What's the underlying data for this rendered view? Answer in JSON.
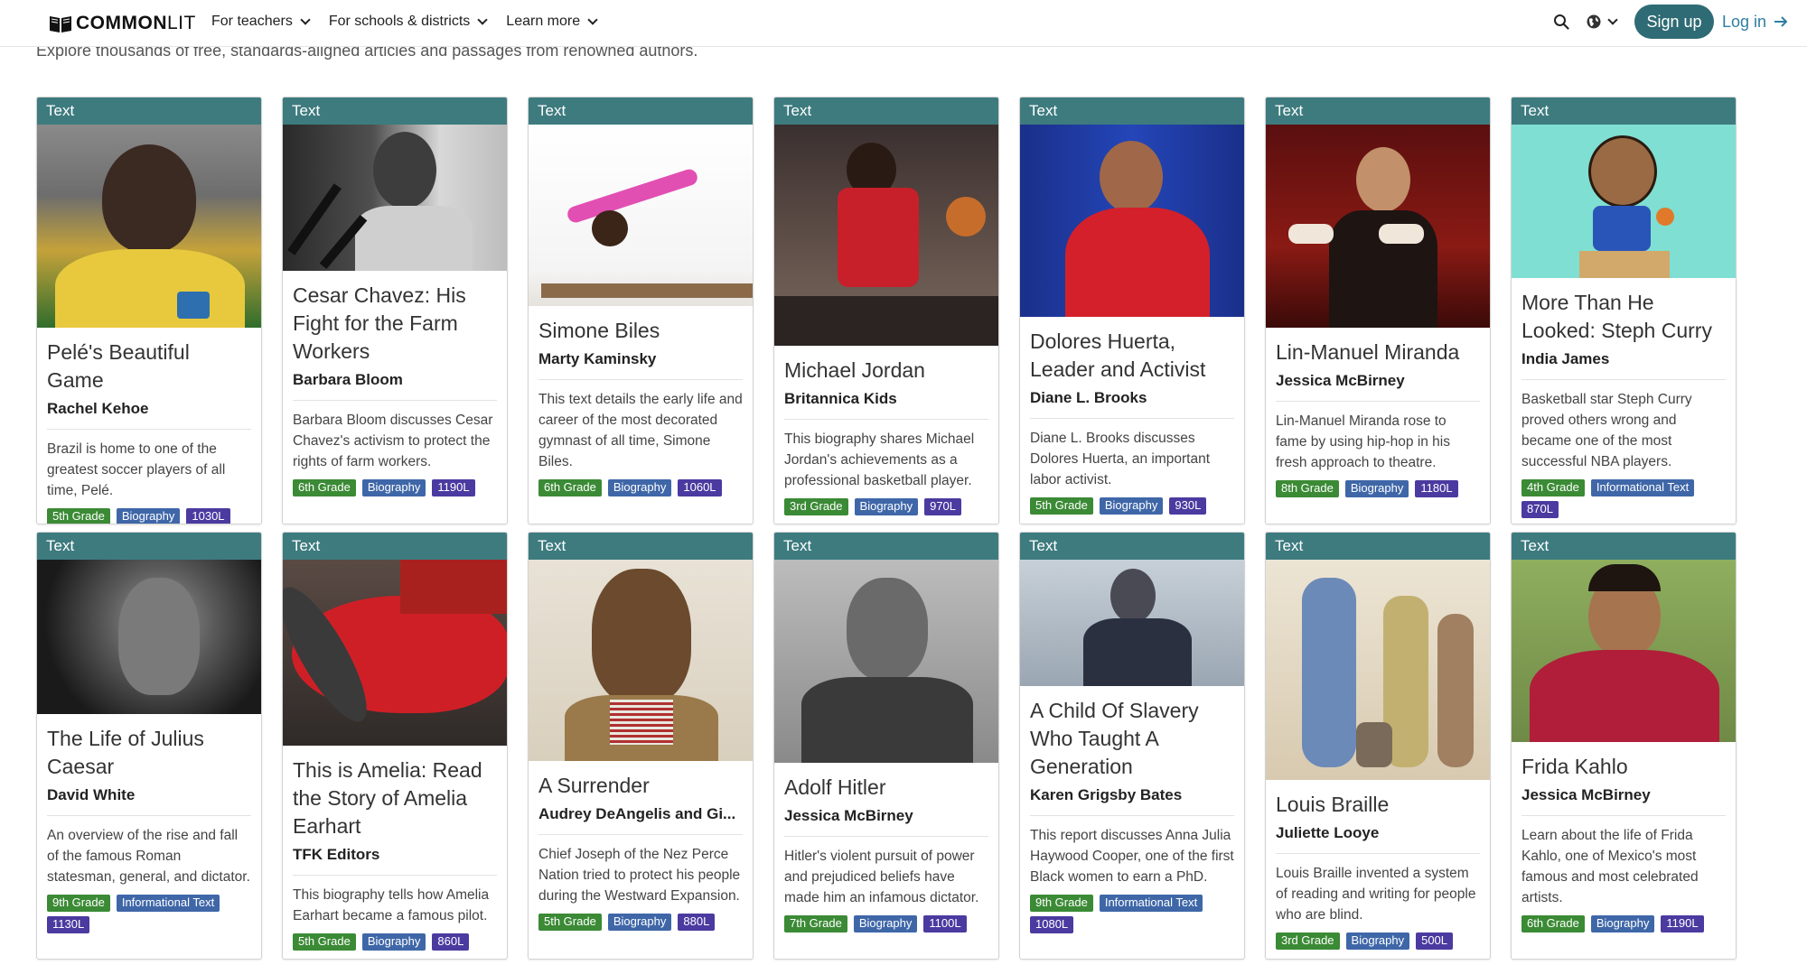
{
  "header": {
    "logo_text_a": "COMMON",
    "logo_text_b": "LIT",
    "nav": [
      {
        "label": "For teachers"
      },
      {
        "label": "For schools & districts"
      },
      {
        "label": "Learn more"
      }
    ],
    "signup_label": "Sign up",
    "login_label": "Log in"
  },
  "subtitle": "Explore thousands of free, standards-aligned articles and passages from renowned authors.",
  "colors": {
    "accent": "#2f6b74",
    "card_header": "#3d7b7f",
    "grade_tag": "#3b8a35",
    "genre_tag": "#3f67a8",
    "lexile_tag": "#4b3aa0",
    "link": "#2f7ea1"
  },
  "cards": [
    {
      "type": "Text",
      "title": "Pelé's Beautiful Game",
      "author": "Rachel Kehoe",
      "desc": "Brazil is home to one of the greatest soccer players of all time, Pelé.",
      "grade": "5th Grade",
      "genre": "Biography",
      "lexile": "1030L"
    },
    {
      "type": "Text",
      "title": "Cesar Chavez: His Fight for the Farm Workers",
      "author": "Barbara Bloom",
      "desc": "Barbara Bloom discusses Cesar Chavez's activism to protect the rights of farm workers.",
      "grade": "6th Grade",
      "genre": "Biography",
      "lexile": "1190L"
    },
    {
      "type": "Text",
      "title": "Simone Biles",
      "author": "Marty Kaminsky",
      "desc": "This text details the early life and career of the most decorated gymnast of all time, Simone Biles.",
      "grade": "6th Grade",
      "genre": "Biography",
      "lexile": "1060L"
    },
    {
      "type": "Text",
      "title": "Michael Jordan",
      "author": "Britannica Kids",
      "desc": "This biography shares Michael Jordan's achievements as a professional basketball player.",
      "grade": "3rd Grade",
      "genre": "Biography",
      "lexile": "970L"
    },
    {
      "type": "Text",
      "title": "Dolores Huerta, Leader and Activist",
      "author": "Diane L. Brooks",
      "desc": "Diane L. Brooks discusses Dolores Huerta, an important labor activist.",
      "grade": "5th Grade",
      "genre": "Biography",
      "lexile": "930L"
    },
    {
      "type": "Text",
      "title": "Lin-Manuel Miranda",
      "author": "Jessica McBirney",
      "desc": "Lin-Manuel Miranda rose to fame by using hip-hop in his fresh approach to theatre.",
      "grade": "8th Grade",
      "genre": "Biography",
      "lexile": "1180L"
    },
    {
      "type": "Text",
      "title": "More Than He Looked: Steph Curry",
      "author": "India James",
      "desc": "Basketball star Steph Curry proved others wrong and became one of the most successful NBA players.",
      "grade": "4th Grade",
      "genre": "Informational Text",
      "lexile": "870L"
    },
    {
      "type": "Text",
      "title": "The Life of Julius Caesar",
      "author": "David White",
      "desc": "An overview of the rise and fall of the famous Roman statesman, general, and dictator.",
      "grade": "9th Grade",
      "genre": "Informational Text",
      "lexile": "1130L"
    },
    {
      "type": "Text",
      "title": "This is Amelia: Read the Story of Amelia Earhart",
      "author": "TFK Editors",
      "desc": "This biography tells how Amelia Earhart became a famous pilot.",
      "grade": "5th Grade",
      "genre": "Biography",
      "lexile": "860L"
    },
    {
      "type": "Text",
      "title": "A Surrender",
      "author": "Audrey DeAngelis and Gi...",
      "desc": "Chief Joseph of the Nez Perce Nation tried to protect his people during the Westward Expansion.",
      "grade": "5th Grade",
      "genre": "Biography",
      "lexile": "880L"
    },
    {
      "type": "Text",
      "title": "Adolf Hitler",
      "author": "Jessica McBirney",
      "desc": "Hitler's violent pursuit of power and prejudiced beliefs have made him an infamous dictator.",
      "grade": "7th Grade",
      "genre": "Biography",
      "lexile": "1100L"
    },
    {
      "type": "Text",
      "title": "A Child Of Slavery Who Taught A Generation",
      "author": "Karen Grigsby Bates",
      "desc": "This report discusses Anna Julia Haywood Cooper, one of the first Black women to earn a PhD.",
      "grade": "9th Grade",
      "genre": "Informational Text",
      "lexile": "1080L"
    },
    {
      "type": "Text",
      "title": "Louis Braille",
      "author": "Juliette Looye",
      "desc": "Louis Braille invented a system of reading and writing for people who are blind.",
      "grade": "3rd Grade",
      "genre": "Biography",
      "lexile": "500L"
    },
    {
      "type": "Text",
      "title": "Frida Kahlo",
      "author": "Jessica McBirney",
      "desc": "Learn about the life of Frida Kahlo, one of Mexico's most famous and most celebrated artists.",
      "grade": "6th Grade",
      "genre": "Biography",
      "lexile": "1190L"
    }
  ]
}
